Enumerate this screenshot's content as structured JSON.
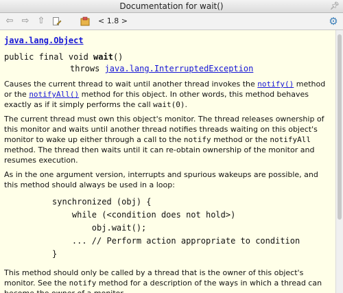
{
  "window": {
    "title": "Documentation for wait()"
  },
  "toolbar": {
    "version": "< 1.8 >"
  },
  "doc": {
    "package": "java.lang.Object",
    "signature_prefix": "public final void ",
    "method": "wait",
    "signature_suffix": "()",
    "throws_kw": "throws ",
    "throws_link": "java.lang.InterruptedException",
    "p1": {
      "t1": "Causes the current thread to wait until another thread invokes the ",
      "link1": "notify()",
      "t2": " method or the ",
      "link2": "notifyAll()",
      "t3": " method for this object. In other words, this method behaves exactly as if it simply performs the call ",
      "code1": "wait(0)",
      "t4": "."
    },
    "p2": {
      "t1": "The current thread must own this object's monitor. The thread releases ownership of this monitor and waits until another thread notifies threads waiting on this object's monitor to wake up either through a call to the ",
      "code1": "notify",
      "t2": " method or the ",
      "code2": "notifyAll",
      "t3": " method. The thread then waits until it can re-obtain ownership of the monitor and resumes execution."
    },
    "p3": "As in the one argument version, interrupts and spurious wakeups are possible, and this method should always be used in a loop:",
    "code_block": "synchronized (obj) {\n    while (<condition does not hold>)\n        obj.wait();\n    ... // Perform action appropriate to condition\n}",
    "p4": {
      "t1": "This method should only be called by a thread that is the owner of this object's monitor. See the ",
      "code1": "notify",
      "t2": " method for a description of the ways in which a thread can become the owner of a monitor."
    }
  }
}
